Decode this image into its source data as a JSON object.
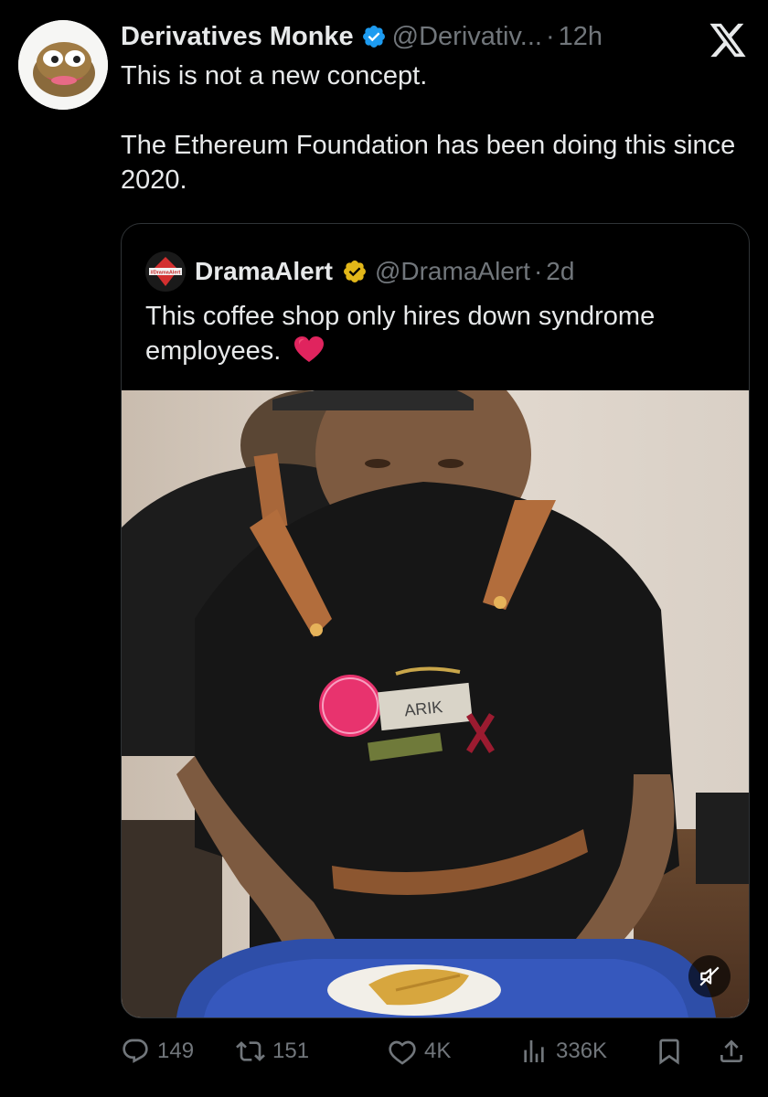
{
  "tweet": {
    "author": {
      "display_name": "Derivatives Monke",
      "handle": "@Derivativ...",
      "verified": true
    },
    "separator": "·",
    "time": "12h",
    "text_lines": [
      "This is not a new concept.",
      "The Ethereum Foundation has been doing this since 2020."
    ]
  },
  "quoted_tweet": {
    "author": {
      "display_name": "DramaAlert",
      "handle": "@DramaAlert",
      "verified_color": "#e2b719",
      "avatar_text": "#DramaAlert"
    },
    "separator": "·",
    "time": "2d",
    "text": "This coffee shop only hires down syndrome employees.",
    "emoji": "red-heart",
    "media": {
      "type": "video",
      "muted": true,
      "visible_text": {
        "name_tag": "ARIK"
      }
    }
  },
  "actions": {
    "replies": "149",
    "reposts": "151",
    "likes": "4K",
    "views": "336K"
  },
  "icons": [
    "x-logo",
    "verified-badge-icon",
    "reply-icon",
    "repost-icon",
    "like-icon",
    "views-icon",
    "bookmark-icon",
    "share-icon",
    "mute-icon"
  ],
  "colors": {
    "background": "#000000",
    "text_primary": "#e7e9ea",
    "text_secondary": "#71767b",
    "verified_blue": "#1d9bf0",
    "border": "#2f3336"
  }
}
